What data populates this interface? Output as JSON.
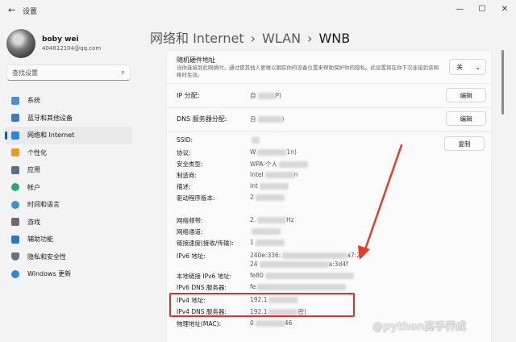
{
  "window": {
    "title": "设置",
    "back_glyph": "←",
    "controls": [
      "—",
      "☐",
      "✕"
    ]
  },
  "profile": {
    "name": "boby wei",
    "email": "404812104@qq.com"
  },
  "search": {
    "placeholder": "查找设置",
    "icon": "search-icon"
  },
  "nav": [
    {
      "label": "系统",
      "icon": "monitor-icon",
      "color": "#4a8fd6",
      "active": false
    },
    {
      "label": "蓝牙和其他设备",
      "icon": "bluetooth-devices-icon",
      "color": "#3b7dc4",
      "active": false
    },
    {
      "label": "网络和 Internet",
      "icon": "network-icon",
      "color": "#2b88d8",
      "active": true
    },
    {
      "label": "个性化",
      "icon": "brush-icon",
      "color": "#e39b2c",
      "active": false
    },
    {
      "label": "应用",
      "icon": "apps-icon",
      "color": "#5a6e8c",
      "active": false
    },
    {
      "label": "帐户",
      "icon": "account-icon",
      "color": "#2fa56e",
      "active": false
    },
    {
      "label": "时间和语言",
      "icon": "globe-clock-icon",
      "color": "#3c8fdc",
      "active": false
    },
    {
      "label": "游戏",
      "icon": "gamepad-icon",
      "color": "#6b6b6b",
      "active": false
    },
    {
      "label": "辅助功能",
      "icon": "accessibility-icon",
      "color": "#2a78c8",
      "active": false
    },
    {
      "label": "隐私和安全性",
      "icon": "shield-icon",
      "color": "#6b7380",
      "active": false
    },
    {
      "label": "Windows 更新",
      "icon": "update-icon",
      "color": "#2a88d8",
      "active": false
    }
  ],
  "breadcrumb": {
    "level1": "网络和 Internet",
    "sep": "›",
    "level2": "WLAN",
    "level3": "WNB"
  },
  "random_hw": {
    "title": "随机硬件地址",
    "desc": "当你连接到此网络时，通过使其他人更难以跟踪你的设备位置来帮助保护你的隐私。此设置将在你下次连接到该网络时生效。",
    "value": "关",
    "chevron": "⌄"
  },
  "ip_assign": {
    "label": "IP 分配:",
    "value": "自",
    "value_tail": "P)",
    "button": "编辑"
  },
  "dns_assign": {
    "label": "DNS 服务器分配:",
    "value": "自",
    "value_tail": ")",
    "button": "编辑"
  },
  "copy_button": "复制",
  "props": [
    {
      "label": "SSID:",
      "value": ""
    },
    {
      "label": "协议:",
      "value": "W",
      "tail": "1n)"
    },
    {
      "label": "安全类型:",
      "value": "WPA-个人",
      "tail": ""
    },
    {
      "label": "制造商:",
      "value": "Intel",
      "tail": "n"
    },
    {
      "label": "描述:",
      "value": "Int",
      "tail": ""
    },
    {
      "label": "驱动程序版本:",
      "value": "2",
      "tail": ""
    },
    {
      "label": "网络频带:",
      "value": "2.",
      "tail": "Hz"
    },
    {
      "label": "网络通道:",
      "value": "",
      "tail": ""
    },
    {
      "label": "链接速度(接收/传输):",
      "value": "1",
      "tail": ""
    },
    {
      "label": "IPv6 地址:",
      "value": "240e:336:",
      "tail": "a7:2",
      "line2": "24",
      "line2_tail": "a:3d4f"
    },
    {
      "label": "本地链接 IPv6 地址:",
      "value": "fe80",
      "tail": ""
    },
    {
      "label": "IPv6 DNS 服务器:",
      "value": "fe",
      "tail": ""
    },
    {
      "label": "IPv4 地址:",
      "value": "192.1",
      "tail": ""
    },
    {
      "label": "IPv4 DNS 服务器:",
      "value": "192.1",
      "tail": "密)"
    },
    {
      "label": "物理地址(MAC):",
      "value": "0",
      "tail": "46"
    }
  ],
  "watermark": "@python高手养成",
  "highlight_color": "#d9322b"
}
